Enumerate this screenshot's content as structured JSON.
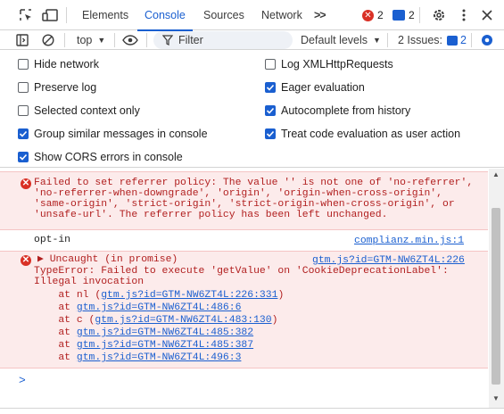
{
  "tabs": {
    "items": [
      "Elements",
      "Console",
      "Sources",
      "Network"
    ],
    "more": ">>",
    "errors_count": "2",
    "messages_count": "2"
  },
  "toolbar": {
    "context": "top",
    "filter_placeholder": "Filter",
    "levels": "Default levels",
    "issues_label": "2 Issues:",
    "issues_count": "2"
  },
  "settings": {
    "left": [
      {
        "label": "Hide network",
        "checked": false
      },
      {
        "label": "Preserve log",
        "checked": false
      },
      {
        "label": "Selected context only",
        "checked": false
      },
      {
        "label": "Group similar messages in console",
        "checked": true
      },
      {
        "label": "Show CORS errors in console",
        "checked": true
      }
    ],
    "right": [
      {
        "label": "Log XMLHttpRequests",
        "checked": false
      },
      {
        "label": "Eager evaluation",
        "checked": true
      },
      {
        "label": "Autocomplete from history",
        "checked": true
      },
      {
        "label": "Treat code evaluation as user action",
        "checked": true
      }
    ]
  },
  "console": {
    "msg1": {
      "lines": [
        "Failed to set referrer policy: The value '' is not one of 'no-referrer',",
        "'no-referrer-when-downgrade', 'origin', 'origin-when-cross-origin',",
        "'same-origin', 'strict-origin', 'strict-origin-when-cross-origin', or",
        "'unsafe-url'. The referrer policy has been left unchanged."
      ]
    },
    "msg2": {
      "text": "opt-in",
      "source": "complianz.min.js:1"
    },
    "msg3": {
      "head": "▶ Uncaught (in promise)",
      "source": "gtm.js?id=GTM-NW6ZT4L:226",
      "body": [
        "TypeError: Failed to execute 'getValue' on 'CookieDeprecationLabel':",
        "Illegal invocation"
      ],
      "stack": [
        {
          "prefix": "    at nl (",
          "link": "gtm.js?id=GTM-NW6ZT4L:226:331",
          "suffix": ")"
        },
        {
          "prefix": "    at ",
          "link": "gtm.js?id=GTM-NW6ZT4L:486:6",
          "suffix": ""
        },
        {
          "prefix": "    at c (",
          "link": "gtm.js?id=GTM-NW6ZT4L:483:130",
          "suffix": ")"
        },
        {
          "prefix": "    at ",
          "link": "gtm.js?id=GTM-NW6ZT4L:485:382",
          "suffix": ""
        },
        {
          "prefix": "    at ",
          "link": "gtm.js?id=GTM-NW6ZT4L:485:387",
          "suffix": ""
        },
        {
          "prefix": "    at ",
          "link": "gtm.js?id=GTM-NW6ZT4L:496:3",
          "suffix": ""
        }
      ]
    },
    "prompt": ">"
  },
  "colors": {
    "accent": "#1a5fd0",
    "error": "#d93025",
    "error_bg": "#fcebeb"
  }
}
